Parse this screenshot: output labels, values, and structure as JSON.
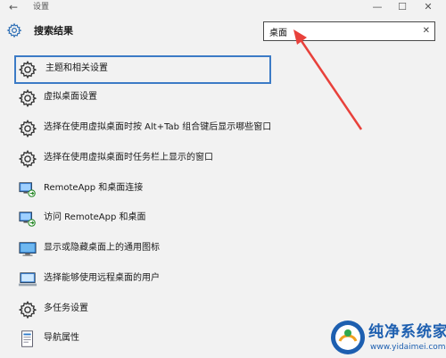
{
  "window": {
    "title": "设置",
    "back_glyph": "←",
    "minimize_glyph": "—",
    "maximize_glyph": "☐",
    "close_glyph": "✕"
  },
  "header": {
    "title": "搜索结果",
    "icon": "gear-icon"
  },
  "search": {
    "value": "桌面",
    "clear_glyph": "✕"
  },
  "results": [
    {
      "label": "主题和相关设置",
      "icon": "gear-icon",
      "selected": true
    },
    {
      "label": "虚拟桌面设置",
      "icon": "gear-icon"
    },
    {
      "label": "选择在使用虚拟桌面时按 Alt+Tab 组合键后显示哪些窗口",
      "icon": "gear-icon"
    },
    {
      "label": "选择在使用虚拟桌面时任务栏上显示的窗口",
      "icon": "gear-icon"
    },
    {
      "label": "RemoteApp 和桌面连接",
      "icon": "remote-desktop-icon"
    },
    {
      "label": "访问 RemoteApp 和桌面",
      "icon": "remote-desktop-icon"
    },
    {
      "label": "显示或隐藏桌面上的通用图标",
      "icon": "desktop-monitor-icon"
    },
    {
      "label": "选择能够使用远程桌面的用户",
      "icon": "remote-users-icon"
    },
    {
      "label": "多任务设置",
      "icon": "gear-icon"
    },
    {
      "label": "导航属性",
      "icon": "navigation-properties-icon"
    }
  ],
  "watermark": {
    "name": "纯净系统家园",
    "url": "www.yidaimei.com"
  },
  "colors": {
    "selection_border": "#3c7bc6",
    "arrow": "#e8413b",
    "watermark": "#1d5fb0"
  }
}
